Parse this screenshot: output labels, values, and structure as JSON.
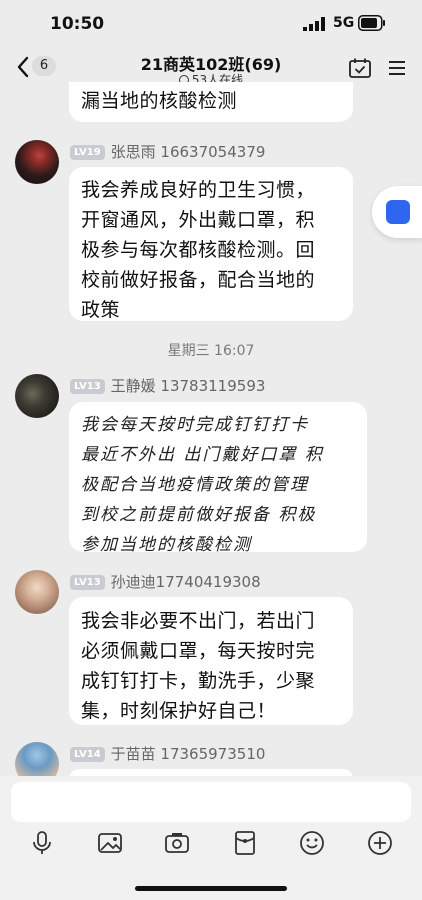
{
  "status_bar": {
    "time": "10:50",
    "network": "5G"
  },
  "header": {
    "back_badge": "6",
    "title": "21商英102班(69)",
    "online": "53人在线"
  },
  "messages": [
    {
      "text": "漏当地的核酸检测"
    },
    {
      "level": "LV19",
      "name": "张思雨 16637054379",
      "lines": [
        "我会养成良好的卫生习惯，",
        "开窗通风，外出戴口罩，积",
        "极参与每次都核酸检测。回",
        "校前做好报备，配合当地的",
        "政策"
      ]
    },
    {
      "level": "LV13",
      "name": "王静媛 13783119593",
      "lines": [
        "我会每天按时完成钉钉打卡",
        "最近不外出 出门戴好口罩 积",
        "极配合当地疫情政策的管理",
        "到校之前提前做好报备 积极",
        "参加当地的核酸检测"
      ]
    },
    {
      "level": "LV13",
      "name": "孙迪迪17740419308",
      "lines": [
        "我会非必要不出门，若出门",
        "必须佩戴口罩，每天按时完",
        "成钉钉打卡，勤洗手，少聚",
        "集，时刻保护好自己！"
      ]
    },
    {
      "level": "LV14",
      "name": "于苗苗 17365973510"
    }
  ],
  "separator": "星期三 16:07",
  "colors": {
    "accent": "#2f66f0",
    "background": "#ececec",
    "bubble": "#ffffff"
  },
  "toolbar": [
    "microphone-icon",
    "image-icon",
    "camera-icon",
    "red-packet-icon",
    "emoji-icon",
    "plus-icon"
  ]
}
